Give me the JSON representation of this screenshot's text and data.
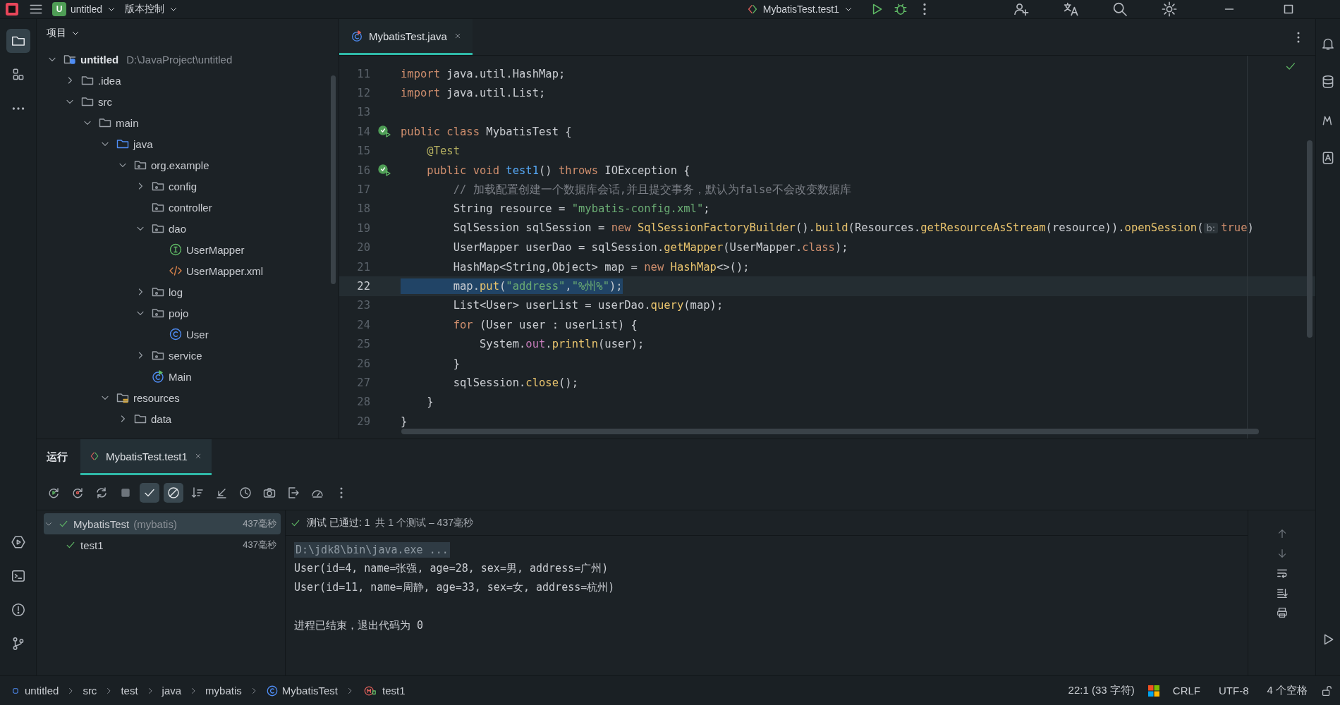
{
  "title_bar": {
    "project_badge": "U",
    "project": "untitled",
    "vcs": "版本控制",
    "run_config": "MybatisTest.test1"
  },
  "left_toolbar": [
    {
      "kind": "project",
      "selected": true
    },
    {
      "kind": "structure",
      "selected": false
    },
    {
      "kind": "more",
      "selected": false
    }
  ],
  "left_toolbar_bottom": [
    {
      "kind": "services"
    },
    {
      "kind": "terminal"
    },
    {
      "kind": "problems"
    },
    {
      "kind": "git"
    }
  ],
  "project_panel": {
    "title": "项目"
  },
  "project_tree": [
    {
      "name": "untitled",
      "path": "D:\\JavaProject\\untitled",
      "kind": "project",
      "expanded": true,
      "children": [
        {
          "name": ".idea",
          "kind": "folder",
          "expanded": false
        },
        {
          "name": "src",
          "kind": "folder",
          "expanded": true,
          "children": [
            {
              "name": "main",
              "kind": "folder",
              "expanded": true,
              "children": [
                {
                  "name": "java",
                  "kind": "source",
                  "expanded": true,
                  "children": [
                    {
                      "name": "org.example",
                      "kind": "package",
                      "expanded": true,
                      "children": [
                        {
                          "name": "config",
                          "kind": "package",
                          "expanded": false
                        },
                        {
                          "name": "controller",
                          "kind": "package"
                        },
                        {
                          "name": "dao",
                          "kind": "package",
                          "expanded": true,
                          "children": [
                            {
                              "name": "UserMapper",
                              "kind": "interface"
                            },
                            {
                              "name": "UserMapper.xml",
                              "kind": "xml"
                            }
                          ]
                        },
                        {
                          "name": "log",
                          "kind": "package",
                          "expanded": false
                        },
                        {
                          "name": "pojo",
                          "kind": "package",
                          "expanded": true,
                          "children": [
                            {
                              "name": "User",
                              "kind": "class"
                            }
                          ]
                        },
                        {
                          "name": "service",
                          "kind": "package",
                          "expanded": false
                        },
                        {
                          "name": "Main",
                          "kind": "main"
                        }
                      ]
                    }
                  ]
                },
                {
                  "name": "resources",
                  "kind": "resources",
                  "expanded": true,
                  "children": [
                    {
                      "name": "data",
                      "kind": "folder",
                      "expanded": false
                    }
                  ]
                }
              ]
            }
          ]
        }
      ]
    }
  ],
  "editor": {
    "tab": "MybatisTest.java",
    "lines": [
      {
        "n": "11",
        "current": false,
        "selected": false,
        "tokens": [
          {
            "kind": "kw",
            "t": "import"
          },
          {
            "kind": "p",
            "t": " java.util.HashMap;"
          }
        ]
      },
      {
        "n": "12",
        "current": false,
        "selected": false,
        "tokens": [
          {
            "kind": "kw",
            "t": "import"
          },
          {
            "kind": "p",
            "t": " java.util.List;"
          }
        ]
      },
      {
        "n": "13",
        "current": false
      },
      {
        "n": "14",
        "current": false,
        "selected": false,
        "gutter": {
          "kind": "run"
        },
        "tokens": [
          {
            "kind": "kw",
            "t": "public class"
          },
          {
            "kind": "p",
            "t": " MybatisTest {"
          }
        ]
      },
      {
        "n": "15",
        "current": false,
        "selected": false,
        "tokens": [
          {
            "kind": "ann",
            "t": "    @Test"
          }
        ]
      },
      {
        "n": "16",
        "current": false,
        "selected": false,
        "gutter": {
          "kind": "run"
        },
        "tokens": [
          {
            "kind": "kw",
            "t": "    public void "
          },
          {
            "kind": "decl",
            "t": "test1"
          },
          {
            "kind": "p",
            "t": "() "
          },
          {
            "kind": "kw",
            "t": "throws"
          },
          {
            "kind": "p",
            "t": " IOException {"
          }
        ]
      },
      {
        "n": "17",
        "current": false,
        "selected": false,
        "tokens": [
          {
            "kind": "cmt",
            "t": "        // 加载配置创建一个数据库会话,并且提交事务，默认为false不会改变数据库"
          }
        ]
      },
      {
        "n": "18",
        "current": false,
        "selected": false,
        "tokens": [
          {
            "kind": "p",
            "t": "        String resource = "
          },
          {
            "kind": "str",
            "t": "\"mybatis-config.xml\""
          },
          {
            "kind": "p",
            "t": ";"
          }
        ]
      },
      {
        "n": "19",
        "current": false,
        "selected": false,
        "tokens": [
          {
            "kind": "p",
            "t": "        SqlSession sqlSession = "
          },
          {
            "kind": "kw",
            "t": "new "
          },
          {
            "kind": "fn",
            "t": "SqlSessionFactoryBuilder"
          },
          {
            "kind": "p",
            "t": "()."
          },
          {
            "kind": "fn",
            "t": "build"
          },
          {
            "kind": "p",
            "t": "(Resources."
          },
          {
            "kind": "fn",
            "t": "getResourceAsStream"
          },
          {
            "kind": "p",
            "t": "(resource))."
          },
          {
            "kind": "fn",
            "t": "openSession"
          },
          {
            "kind": "p",
            "t": "("
          },
          {
            "kind": "hint",
            "t": "b:"
          },
          {
            "kind": "kw",
            "t": "true"
          },
          {
            "kind": "p",
            "t": ")"
          }
        ]
      },
      {
        "n": "20",
        "current": false,
        "selected": false,
        "tokens": [
          {
            "kind": "p",
            "t": "        UserMapper userDao = sqlSession."
          },
          {
            "kind": "fn",
            "t": "getMapper"
          },
          {
            "kind": "p",
            "t": "(UserMapper."
          },
          {
            "kind": "kw",
            "t": "class"
          },
          {
            "kind": "p",
            "t": ");"
          }
        ]
      },
      {
        "n": "21",
        "current": false,
        "selected": false,
        "tokens": [
          {
            "kind": "p",
            "t": "        HashMap<String,Object> map = "
          },
          {
            "kind": "kw",
            "t": "new "
          },
          {
            "kind": "fn",
            "t": "HashMap"
          },
          {
            "kind": "p",
            "t": "<>();"
          }
        ]
      },
      {
        "n": "22",
        "current": true,
        "selected": true,
        "tokens": [
          {
            "kind": "p",
            "t": "        map."
          },
          {
            "kind": "fn",
            "t": "put"
          },
          {
            "kind": "p",
            "t": "("
          },
          {
            "kind": "str",
            "t": "\"address\""
          },
          {
            "kind": "p",
            "t": ","
          },
          {
            "kind": "str",
            "t": "\"%州%\""
          },
          {
            "kind": "p",
            "t": ");"
          }
        ]
      },
      {
        "n": "23",
        "current": false,
        "selected": false,
        "tokens": [
          {
            "kind": "p",
            "t": "        List<User> userList = userDao."
          },
          {
            "kind": "fn",
            "t": "query"
          },
          {
            "kind": "p",
            "t": "(map);"
          }
        ]
      },
      {
        "n": "24",
        "current": false,
        "selected": false,
        "tokens": [
          {
            "kind": "kw",
            "t": "        for"
          },
          {
            "kind": "p",
            "t": " (User user : userList) {"
          }
        ]
      },
      {
        "n": "25",
        "current": false,
        "selected": false,
        "tokens": [
          {
            "kind": "p",
            "t": "            System."
          },
          {
            "kind": "field",
            "t": "out"
          },
          {
            "kind": "p",
            "t": "."
          },
          {
            "kind": "fn",
            "t": "println"
          },
          {
            "kind": "p",
            "t": "(user);"
          }
        ]
      },
      {
        "n": "26",
        "current": false,
        "selected": false,
        "tokens": [
          {
            "kind": "p",
            "t": "        }"
          }
        ]
      },
      {
        "n": "27",
        "current": false,
        "selected": false,
        "tokens": [
          {
            "kind": "p",
            "t": "        sqlSession."
          },
          {
            "kind": "fn",
            "t": "close"
          },
          {
            "kind": "p",
            "t": "();"
          }
        ]
      },
      {
        "n": "28",
        "current": false,
        "selected": false,
        "tokens": [
          {
            "kind": "p",
            "t": "    }"
          }
        ]
      },
      {
        "n": "29",
        "current": false,
        "selected": false,
        "tokens": [
          {
            "kind": "p",
            "t": "}"
          }
        ]
      }
    ]
  },
  "run_panel": {
    "title": "运行",
    "tab": "MybatisTest.test1",
    "toolbar": [
      {
        "kind": "rerun",
        "on": false
      },
      {
        "kind": "rerun-failed",
        "on": false
      },
      {
        "kind": "auto-rerun",
        "on": false
      },
      {
        "kind": "stop",
        "on": false
      },
      {
        "kind": "show-passed",
        "on": true
      },
      {
        "kind": "show-ignored",
        "on": true
      },
      {
        "kind": "sort",
        "on": false
      },
      {
        "kind": "import",
        "on": false
      },
      {
        "kind": "history",
        "on": false
      },
      {
        "kind": "camera",
        "on": false
      },
      {
        "kind": "export",
        "on": false
      },
      {
        "kind": "gauge",
        "on": false
      },
      {
        "kind": "more",
        "on": false
      }
    ],
    "tests": [
      {
        "name": "MybatisTest",
        "module": "(mybatis)",
        "time": "437毫秒",
        "passed": true,
        "selected": true,
        "expanded": true,
        "children": [
          {
            "name": "test1",
            "time": "437毫秒",
            "passed": true,
            "selected": false
          }
        ]
      }
    ],
    "status": "测试 已通过: 1",
    "summary": "共 1 个测试 – 437毫秒",
    "console": [
      {
        "kind": "cmd",
        "text": "D:\\jdk8\\bin\\java.exe ..."
      },
      {
        "kind": "out",
        "text": "User(id=4, name=张强, age=28, sex=男, address=广州)"
      },
      {
        "kind": "out",
        "text": "User(id=11, name=周静, age=33, sex=女, address=杭州)"
      },
      {
        "kind": "exit",
        "text": "进程已结束，退出代码为 0"
      }
    ]
  },
  "status_bar": {
    "breadcrumbs": [
      {
        "kind": "module",
        "text": "untitled"
      },
      {
        "kind": "dir",
        "text": "src"
      },
      {
        "kind": "dir",
        "text": "test"
      },
      {
        "kind": "dir",
        "text": "java"
      },
      {
        "kind": "dir",
        "text": "mybatis"
      },
      {
        "kind": "class",
        "text": "MybatisTest"
      },
      {
        "kind": "method",
        "text": "test1"
      }
    ],
    "position": "22:1 (33 字符)",
    "line_ending": "CRLF",
    "encoding": "UTF-8",
    "indent": "4 个空格"
  }
}
